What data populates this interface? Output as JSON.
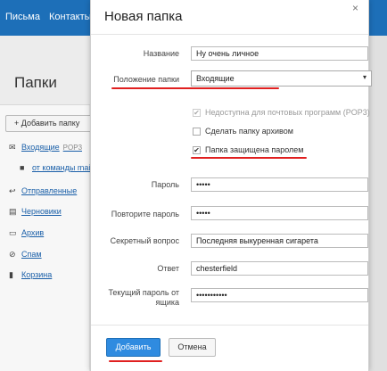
{
  "app": {
    "nav": [
      "Письма",
      "Контакты"
    ],
    "page_title": "Папки",
    "add_folder": "+ Добавить папку",
    "folders": [
      {
        "icon": "inbox-icon",
        "glyph": "✉",
        "label": "Входящие",
        "count": "POP3"
      },
      {
        "icon": "folder-icon",
        "glyph": "■",
        "label": "от команды mail",
        "count": ""
      },
      {
        "icon": "reply-icon",
        "glyph": "↩",
        "label": "Отправленные",
        "count": ""
      },
      {
        "icon": "draft-icon",
        "glyph": "▤",
        "label": "Черновики",
        "count": ""
      },
      {
        "icon": "archive-icon",
        "glyph": "▭",
        "label": "Архив",
        "count": ""
      },
      {
        "icon": "spam-icon",
        "glyph": "⊘",
        "label": "Спам",
        "count": ""
      },
      {
        "icon": "trash-icon",
        "glyph": "▮",
        "label": "Корзина",
        "count": ""
      }
    ]
  },
  "modal": {
    "title": "Новая папка",
    "close_glyph": "×",
    "name_label": "Название",
    "name_value": "Ну очень личное",
    "location_label": "Положение папки",
    "location_value": "Входящие",
    "location_arrow": "▾",
    "chk_pop3": "Недоступна для почтовых программ (POP3)",
    "chk_archive": "Сделать папку архивом",
    "chk_password": "Папка защищена паролем",
    "check_glyph": "✔",
    "password_label": "Пароль",
    "password_value": "•••••",
    "repeat_label": "Повторите пароль",
    "repeat_value": "•••••",
    "question_label": "Секретный вопрос",
    "question_value": "Последняя выкуренная сигарета",
    "answer_label": "Ответ",
    "answer_value": "chesterfield",
    "current_label_1": "Текущий пароль от",
    "current_label_2": "ящика",
    "current_value": "•••••••••••",
    "add_button": "Добавить",
    "cancel_button": "Отмена"
  },
  "colors": {
    "accent": "#2f8be0",
    "topbar": "#1d6fb8",
    "highlight": "#e02020"
  }
}
